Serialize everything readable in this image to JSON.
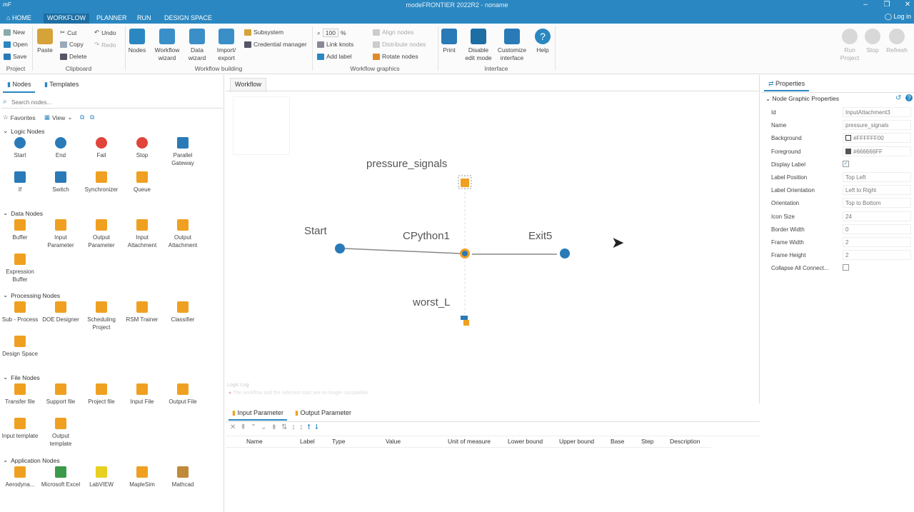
{
  "titlebar": {
    "title": "modeFRONTIER 2022R2 - noname",
    "logo": "mF",
    "tabs": [
      "HOME",
      "WORKFLOW",
      "PLANNER",
      "RUN",
      "DESIGN SPACE"
    ],
    "login": "Log in"
  },
  "ribbon": {
    "project": {
      "new": "New",
      "open": "Open",
      "save": "Save",
      "group": "Project"
    },
    "clipboard": {
      "paste": "Paste",
      "cut": "Cut",
      "copy": "Copy",
      "delete": "Delete",
      "undo": "Undo",
      "redo": "Redo",
      "group": "Clipboard"
    },
    "building": {
      "nodes": "Nodes",
      "workflow_wizard": "Workflow wizard",
      "data_wizard": "Data wizard",
      "import_export": "Import/ export",
      "subsystem": "Subsystem",
      "credential": "Credential manager",
      "group": "Workflow building"
    },
    "graphics": {
      "zoom": "100",
      "zoom_unit": "%",
      "link_knots": "Link knots",
      "add_label": "Add label",
      "align": "Align nodes",
      "distribute": "Distribute nodes",
      "rotate": "Rotate nodes",
      "group": "Workflow graphics"
    },
    "interface": {
      "print": "Print",
      "disable": "Disable edit mode",
      "customize": "Customize interface",
      "help": "Help",
      "group": "Interface"
    },
    "run": {
      "run_project": "Run Project",
      "stop": "Stop",
      "refresh": "Refresh"
    }
  },
  "leftpanel": {
    "tabs": [
      "Nodes",
      "Templates"
    ],
    "search_placeholder": "Search nodes...",
    "favorites": "Favorites",
    "view": "View",
    "sections": [
      {
        "title": "Logic Nodes",
        "nodes": [
          "Start",
          "End",
          "Fail",
          "Stop",
          "Parallel Gateway",
          "If",
          "Switch",
          "Synchronizer",
          "Queue"
        ]
      },
      {
        "title": "Data Nodes",
        "nodes": [
          "Buffer",
          "Input Parameter",
          "Output Parameter",
          "Input Attachment",
          "Output Attachment",
          "Expression Buffer"
        ]
      },
      {
        "title": "Processing Nodes",
        "nodes": [
          "Sub - Process",
          "DOE Designer",
          "Scheduling Project",
          "RSM Trainer",
          "Classifier",
          "Design Space"
        ]
      },
      {
        "title": "File Nodes",
        "nodes": [
          "Transfer file",
          "Support file",
          "Project file",
          "Input File",
          "Output File",
          "Input template",
          "Output template"
        ]
      },
      {
        "title": "Application Nodes",
        "nodes": [
          "Aerodyna...",
          "Microsoft Excel",
          "LabVIEW",
          "MapleSim",
          "Mathcad"
        ]
      }
    ]
  },
  "canvas": {
    "tab": "Workflow",
    "labels": {
      "pressure": "pressure_signals",
      "start": "Start",
      "cpython": "CPython1",
      "exit": "Exit5",
      "worst": "worst_L"
    },
    "logic_log": "Logic Log",
    "log_msg": "The workflow and the selected start are no longer compatible"
  },
  "bottom": {
    "tabs": [
      "Input Parameter",
      "Output Parameter"
    ],
    "columns": [
      "Name",
      "Label",
      "Type",
      "Value",
      "Unit of measure",
      "Lower bound",
      "Upper bound",
      "Base",
      "Step",
      "Description"
    ]
  },
  "properties": {
    "tab": "Properties",
    "section": "Node Graphic Properties",
    "rows": [
      {
        "label": "Id",
        "value": "InputAttachment3"
      },
      {
        "label": "Name",
        "value": "pressure_signals"
      },
      {
        "label": "Background",
        "value": "#FFFFFF00"
      },
      {
        "label": "Foreground",
        "value": "#666666FF"
      },
      {
        "label": "Display Label",
        "value": ""
      },
      {
        "label": "Label Position",
        "value": "Top Left"
      },
      {
        "label": "Label Orientation",
        "value": "Left to Right"
      },
      {
        "label": "Orientation",
        "value": "Top to Bottom"
      },
      {
        "label": "Icon Size",
        "value": "24"
      },
      {
        "label": "Border Width",
        "value": "0"
      },
      {
        "label": "Frame Width",
        "value": "2"
      },
      {
        "label": "Frame Height",
        "value": "2"
      },
      {
        "label": "Collapse All Connect...",
        "value": ""
      }
    ]
  },
  "colors": {
    "accent": "#2a87c1",
    "node_blue": "#2a7ab8",
    "fail_red": "#e0443a",
    "orange": "#f0a020",
    "green": "#3a9a4a"
  }
}
